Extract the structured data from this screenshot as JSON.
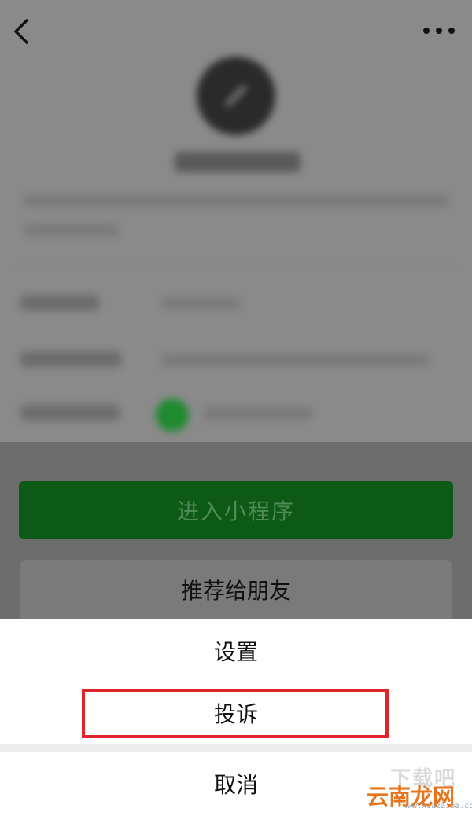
{
  "header": {
    "back_icon": "chevron-left-icon",
    "more_icon": "more-horizontal-icon"
  },
  "actions": {
    "enter_label": "进入小程序",
    "share_label": "推荐给朋友"
  },
  "sheet": {
    "items": [
      {
        "label": "设置"
      },
      {
        "label": "投诉",
        "highlighted": true
      },
      {
        "label": "取消"
      }
    ],
    "highlight_color": "#e0242b"
  },
  "watermark": {
    "text": "云南龙网",
    "top_text": "下载吧",
    "sub_text": "www.xiazaiba.com"
  },
  "colors": {
    "primary_green": "#0d5a16",
    "overlay": "#6d6d6d"
  }
}
